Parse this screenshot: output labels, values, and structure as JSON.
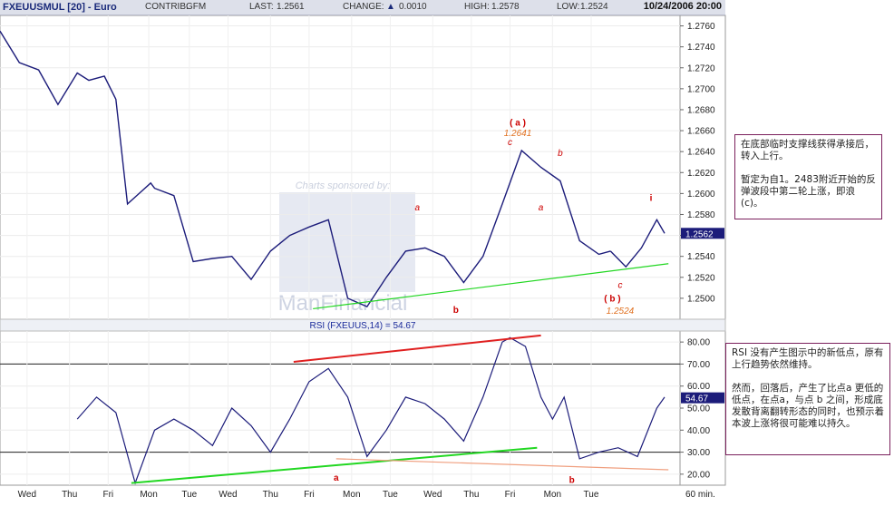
{
  "header": {
    "symbol": "FXEUUSMUL [20] - Euro",
    "contrib_label": "CONTRIB:",
    "contrib_value": "GFM",
    "last_label": "LAST:",
    "last_value": "1.2561",
    "change_label": "CHANGE:",
    "change_value": "0.0010",
    "high_label": "HIGH:",
    "high_value": "1.2578",
    "low_label": "LOW:",
    "low_value": "1.2524",
    "datetime": "10/24/2006 20:00"
  },
  "watermark": {
    "sponsor_text": "Charts sponsored by:",
    "brand_text": "ManFinancial"
  },
  "colors": {
    "price_line": "#1c1c7a",
    "support_line": "#22d722",
    "resistance_line": "#e02020",
    "divergence_line": "#f0a080",
    "annotation_red": "#cc0000",
    "annotation_orange": "#e07020",
    "note_border": "#7a1f5c",
    "last_value_box": "#1c1c7a"
  },
  "chart_data": [
    {
      "type": "line",
      "name": "price",
      "ylim": [
        1.248,
        1.277
      ],
      "y_ticks": [
        "1.2760",
        "1.2740",
        "1.2720",
        "1.2700",
        "1.2680",
        "1.2660",
        "1.2640",
        "1.2620",
        "1.2600",
        "1.2580",
        "1.2560",
        "1.2540",
        "1.2520",
        "1.2500"
      ],
      "last_value_label": "1.2562",
      "x": [
        0,
        0.5,
        1,
        1.5,
        2,
        2.3,
        2.7,
        3,
        3.3,
        3.6,
        3.9,
        4,
        4.5,
        5,
        5.5,
        6,
        6.5,
        7,
        7.5,
        8,
        8.5,
        9,
        9.5,
        10,
        10.5,
        11,
        11.5,
        12,
        12.5,
        13,
        13.5,
        14,
        14.5,
        15,
        15.5,
        15.8
      ],
      "values": [
        1.2755,
        1.2725,
        1.2718,
        1.2685,
        1.2715,
        1.2708,
        1.2712,
        1.269,
        1.259,
        1.26,
        1.261,
        1.2605,
        1.2598,
        1.2535,
        1.2538,
        1.254,
        1.2518,
        1.2545,
        1.256,
        1.2568,
        1.2575,
        1.25,
        1.2492,
        1.252,
        1.2545,
        1.2548,
        1.254,
        1.2515,
        1.254,
        1.259,
        1.2641,
        1.2625,
        1.2612,
        1.2555,
        1.2542,
        1.2545
      ],
      "x_data_end": [
        15.8,
        16.2,
        16.6,
        17.0,
        17.2
      ],
      "values_data_end": [
        1.2545,
        1.253,
        1.2548,
        1.2575,
        1.2562
      ],
      "trendline": {
        "x": [
          8.1,
          17.3
        ],
        "values": [
          1.249,
          1.2533
        ]
      },
      "annotations": [
        {
          "text": "1.2641",
          "x": 13.4,
          "value": 1.2655,
          "style": "orange-italic"
        },
        {
          "text": "( a )",
          "x": 13.4,
          "value": 1.2665,
          "style": "red-bold"
        },
        {
          "text": "c",
          "x": 13.2,
          "value": 1.2646,
          "style": "red"
        },
        {
          "text": "b",
          "x": 14.5,
          "value": 1.2636,
          "style": "red"
        },
        {
          "text": "a",
          "x": 10.8,
          "value": 1.2584,
          "style": "red"
        },
        {
          "text": "a",
          "x": 14.0,
          "value": 1.2584,
          "style": "red"
        },
        {
          "text": "i",
          "x": 16.85,
          "value": 1.2593,
          "style": "red-bold"
        },
        {
          "text": "b",
          "x": 11.8,
          "value": 1.2486,
          "style": "red-bold"
        },
        {
          "text": "c",
          "x": 16.05,
          "value": 1.251,
          "style": "red"
        },
        {
          "text": "( b )",
          "x": 15.85,
          "value": 1.2497,
          "style": "red-bold"
        },
        {
          "text": "1.2524",
          "x": 16.05,
          "value": 1.2485,
          "style": "orange-italic"
        }
      ]
    },
    {
      "type": "line",
      "name": "RSI",
      "title": "RSI (FXEUUS,14) = 54.67",
      "ylim": [
        15,
        85
      ],
      "y_ticks": [
        "80.00",
        "70.00",
        "60.00",
        "50.00",
        "40.00",
        "30.00",
        "20.00"
      ],
      "last_value_label": "54.67",
      "ref_levels": [
        70,
        30
      ],
      "x": [
        2,
        2.5,
        3,
        3.5,
        4,
        4.5,
        5,
        5.5,
        6,
        6.5,
        7,
        7.5,
        8,
        8.5,
        9,
        9.5,
        10,
        10.5,
        11,
        11.5,
        12,
        12.5,
        13,
        13.2,
        13.6,
        14.0,
        14.3,
        14.6,
        15.0,
        15.5,
        16.0,
        16.5,
        17,
        17.2
      ],
      "values": [
        45,
        55,
        48,
        16,
        40,
        45,
        40,
        33,
        50,
        42,
        30,
        45,
        62,
        68,
        55,
        28,
        40,
        55,
        52,
        45,
        35,
        55,
        80,
        82,
        78,
        55,
        45,
        55,
        27,
        30,
        32,
        28,
        50,
        55
      ],
      "resistance": {
        "x": [
          7.6,
          14.0
        ],
        "values": [
          71,
          83
        ]
      },
      "support": {
        "x": [
          3.4,
          13.9
        ],
        "values": [
          16,
          32
        ]
      },
      "divergence": {
        "x": [
          8.7,
          17.3
        ],
        "values": [
          27,
          22
        ]
      },
      "annotations": [
        {
          "text": "a",
          "x": 8.7,
          "value": 17,
          "style": "red-bold"
        },
        {
          "text": "b",
          "x": 14.8,
          "value": 16,
          "style": "red-bold"
        }
      ]
    }
  ],
  "x_axis": {
    "labels": [
      "Wed",
      "Thu",
      "Fri",
      "Mon",
      "Tue",
      "Wed",
      "Thu",
      "Fri",
      "Mon",
      "Tue",
      "Wed",
      "Thu",
      "Fri",
      "Mon",
      "Tue"
    ],
    "positions": [
      0.7,
      1.8,
      2.8,
      3.85,
      4.9,
      5.9,
      7.0,
      8.0,
      9.1,
      10.1,
      11.2,
      12.2,
      13.2,
      14.3,
      15.3
    ],
    "unit_label": "60 min."
  },
  "notes": {
    "price": "在底部临时支撑线获得承接后，转入上行。\n\n暂定为自1。2483附近开始的反弹波段中第二轮上涨，即浪(c)。",
    "rsi": "RSI 没有产生图示中的新低点，原有上行趋势依然维持。\n\n然而，回落后，产生了比点a 更低的低点，在点a，与点 b 之间，形成底发散背离翻转形态的同时，也预示着本波上涨将很可能难以持久。"
  }
}
